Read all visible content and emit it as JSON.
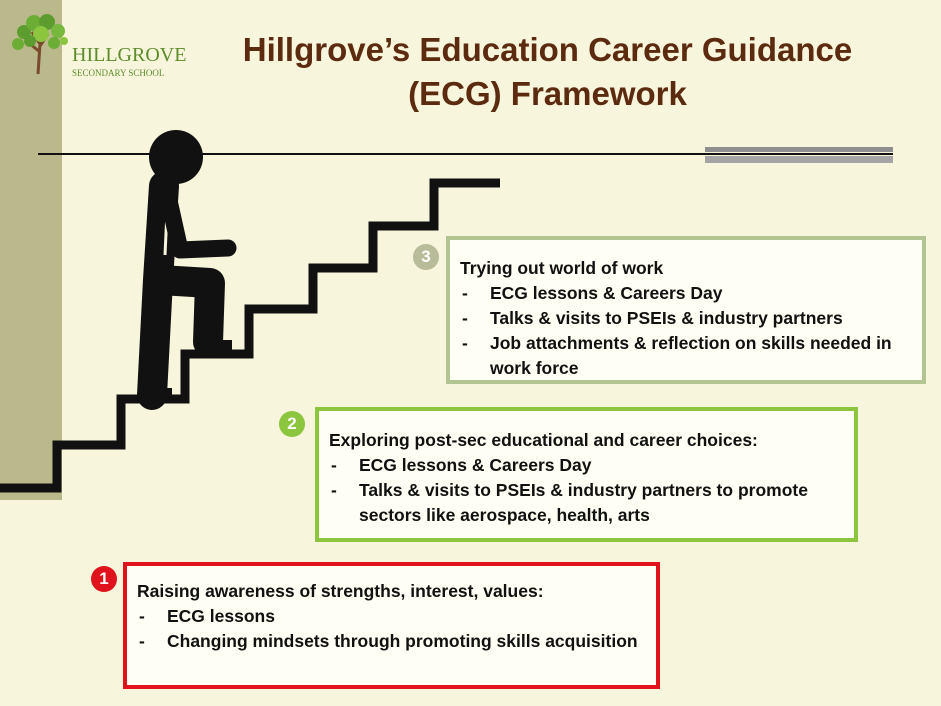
{
  "logo": {
    "name": "HILLGROVE",
    "subtitle": "SECONDARY SCHOOL"
  },
  "title": {
    "line1": "Hillgrove’s Education Career Guidance",
    "line2": "(ECG) Framework"
  },
  "stages": {
    "three": {
      "number": "3",
      "heading": "Trying out world of work",
      "items": [
        "ECG lessons & Careers Day",
        "Talks & visits to PSEIs & industry partners",
        "Job attachments & reflection on skills needed in work force"
      ]
    },
    "two": {
      "number": "2",
      "heading": "Exploring post-sec educational and career choices:",
      "items": [
        "ECG lessons & Careers Day",
        "Talks & visits to PSEIs & industry partners to promote sectors like aerospace, health, arts"
      ]
    },
    "one": {
      "number": "1",
      "heading": "Raising awareness of strengths, interest, values:",
      "items": [
        "ECG lessons",
        "Changing mindsets through promoting skills acquisition"
      ]
    }
  },
  "colors": {
    "title": "#5c2a0e",
    "stage3": "#b3c493",
    "stage2": "#8cc63e",
    "stage1": "#e0121b",
    "background": "#f7f5dc",
    "side_strip": "#bab98b"
  },
  "icons": [
    "tree-logo-icon",
    "stick-figure-icon",
    "staircase-icon"
  ]
}
